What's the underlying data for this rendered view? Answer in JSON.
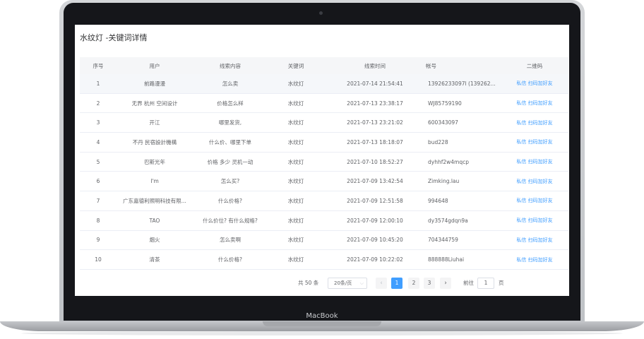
{
  "device": {
    "brand": "MacBook"
  },
  "page": {
    "title": "水纹灯 -关键词详情"
  },
  "table": {
    "headers": [
      "序号",
      "用户",
      "线索内容",
      "关键词",
      "线索时间",
      "帐号",
      "二维码"
    ],
    "rows": [
      {
        "no": "1",
        "user": "前路漫漫",
        "content": "怎么卖",
        "keyword": "水纹灯",
        "time": "2021-07-14 21:54:41",
        "account": "13926233097l (139262...",
        "qr": "私信 扫码加好友"
      },
      {
        "no": "2",
        "user": "无界 杭州 空间设计",
        "content": "价格怎么样",
        "keyword": "水纹灯",
        "time": "2021-07-13 23:38:17",
        "account": "WJ85759190",
        "qr": "私信 扫码加好友"
      },
      {
        "no": "3",
        "user": "开江",
        "content": "哪里发货,",
        "keyword": "水纹灯",
        "time": "2021-07-13 23:21:02",
        "account": "600343097",
        "qr": "私信 扫码加好友"
      },
      {
        "no": "4",
        "user": "不丹 民宿設計機構",
        "content": "什么价、哪里下单",
        "keyword": "水纹灯",
        "time": "2021-07-13 18:18:07",
        "account": "bud228",
        "qr": "私信 扫码加好友"
      },
      {
        "no": "5",
        "user": "巴斯光年",
        "content": "价格 多少 灵机一动",
        "keyword": "水纹灯",
        "time": "2021-07-10 18:52:27",
        "account": "dyhhf2w4mqcp",
        "qr": "私信 扫码加好友"
      },
      {
        "no": "6",
        "user": "I'm",
        "content": "怎么买?",
        "keyword": "水纹灯",
        "time": "2021-07-09 13:42:54",
        "account": "Zimking.lau",
        "qr": "私信 扫码加好友"
      },
      {
        "no": "7",
        "user": "广东嘉德利照明科技有限...",
        "content": "什么价格?",
        "keyword": "水纹灯",
        "time": "2021-07-09 12:51:58",
        "account": "994648",
        "qr": "私信 扫码加好友"
      },
      {
        "no": "8",
        "user": "TAO",
        "content": "什么价位? 有什么规格?",
        "keyword": "水纹灯",
        "time": "2021-07-09 12:00:10",
        "account": "dy3574gdqn9a",
        "qr": "私信 扫码加好友"
      },
      {
        "no": "9",
        "user": "烟火",
        "content": "怎么卖啊",
        "keyword": "水纹灯",
        "time": "2021-07-09 10:45:20",
        "account": "704344759",
        "qr": "私信 扫码加好友"
      },
      {
        "no": "10",
        "user": "清茶",
        "content": "什么价格?",
        "keyword": "水纹灯",
        "time": "2021-07-09 10:22:02",
        "account": "888888Liuhai",
        "qr": "私信 扫码加好友"
      }
    ]
  },
  "pagination": {
    "total": "共 50 条",
    "page_size": "20条/页",
    "pages": [
      "1",
      "2",
      "3"
    ],
    "current": "1",
    "goto_label": "前往",
    "goto_value": "1",
    "goto_unit": "页",
    "prev_icon": "‹",
    "next_icon": "›"
  }
}
